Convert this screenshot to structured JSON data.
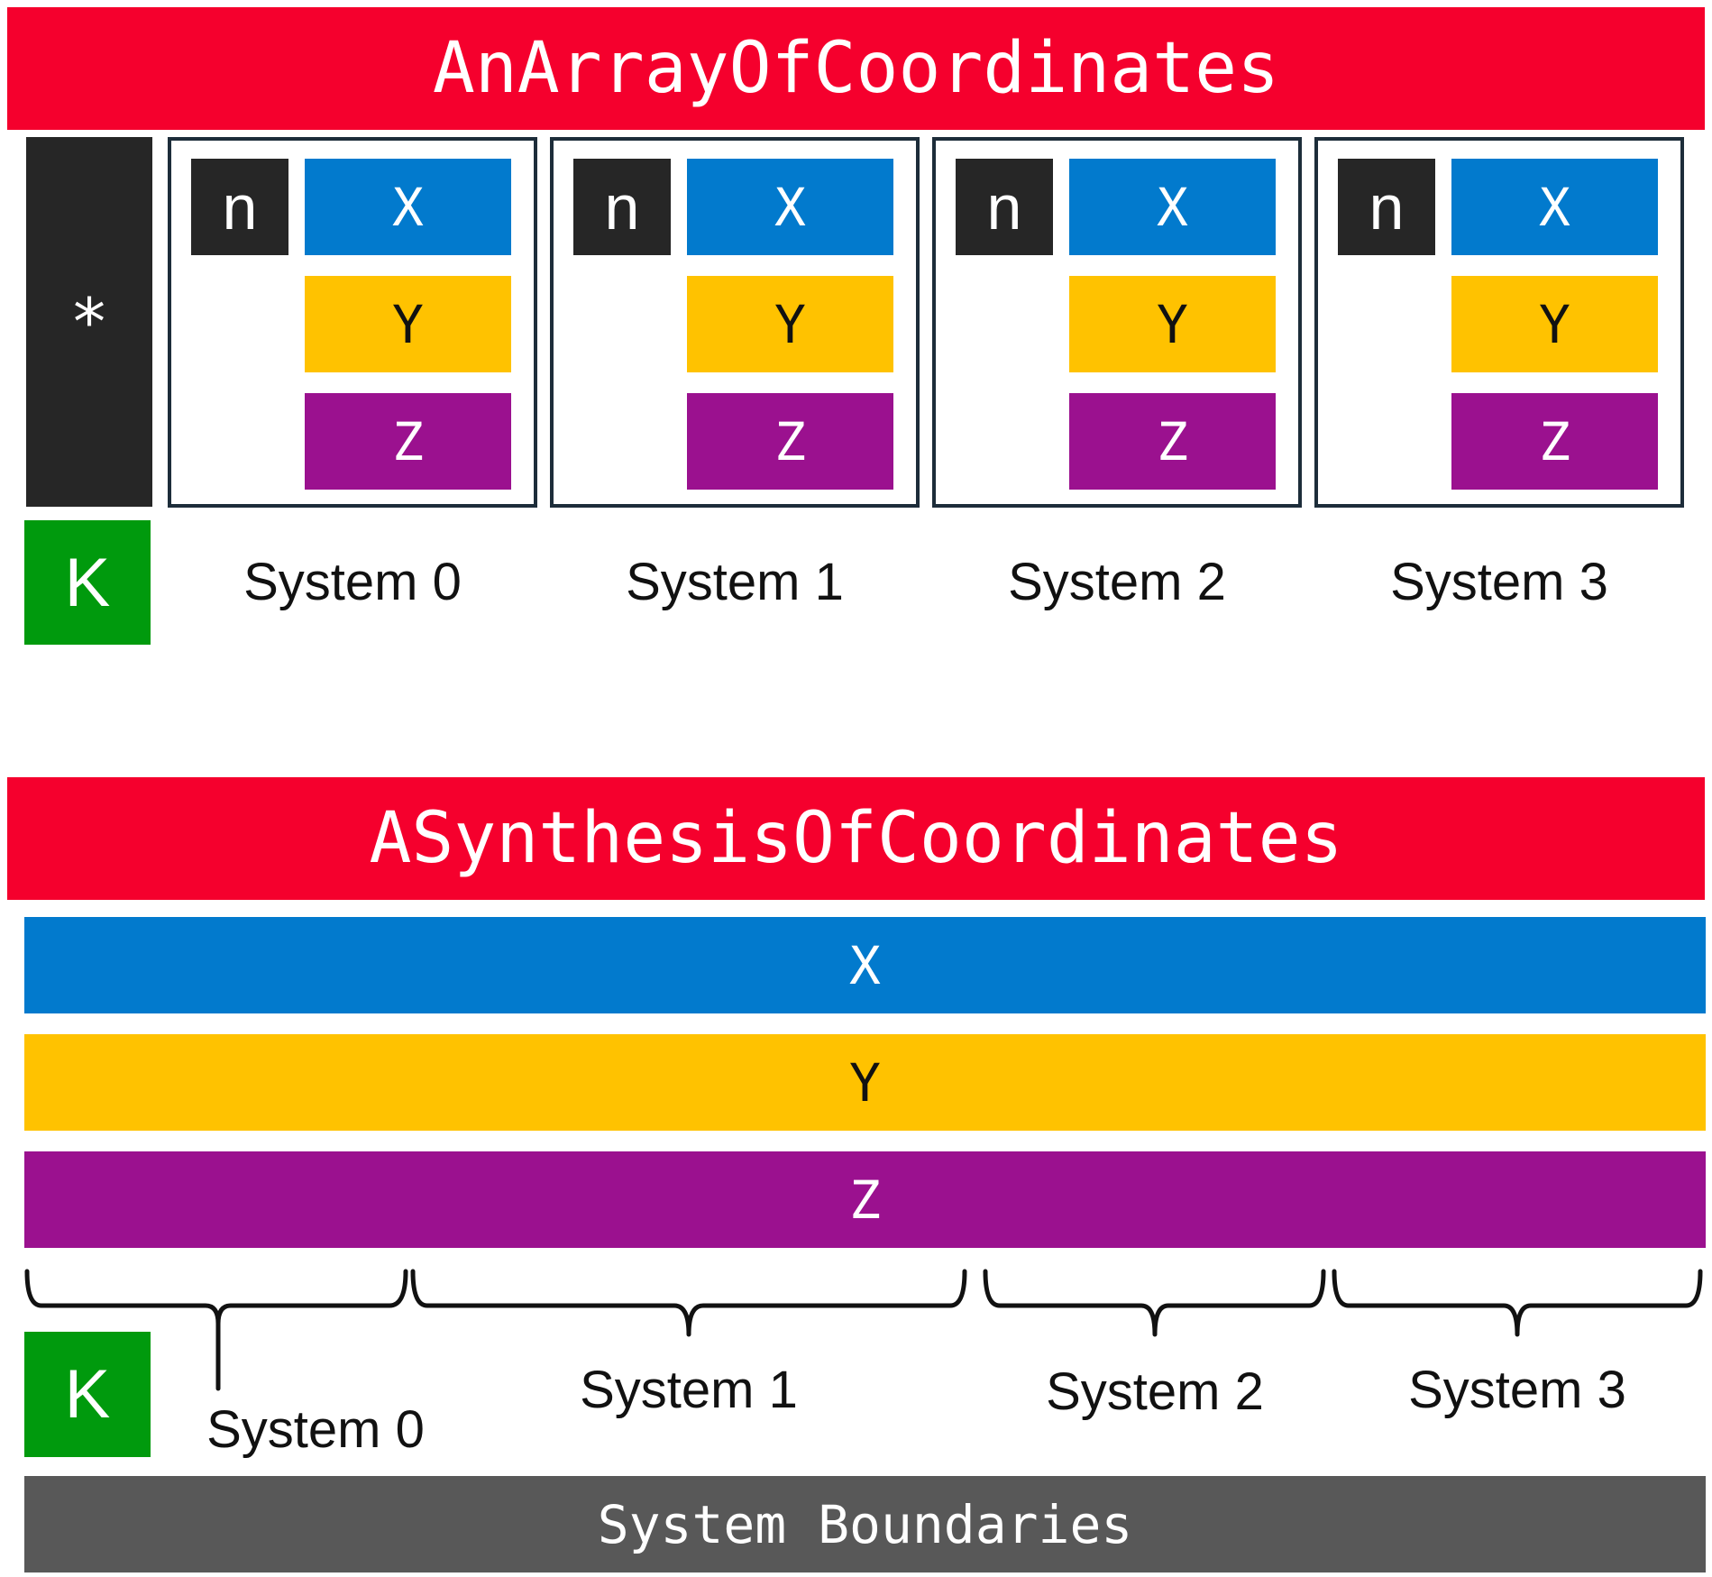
{
  "array_section": {
    "title": "AnArrayOfCoordinates",
    "pointer_label": "*",
    "k_label": "K",
    "systems": [
      {
        "n": "n",
        "x": "X",
        "y": "Y",
        "z": "Z",
        "label": "System 0"
      },
      {
        "n": "n",
        "x": "X",
        "y": "Y",
        "z": "Z",
        "label": "System 1"
      },
      {
        "n": "n",
        "x": "X",
        "y": "Y",
        "z": "Z",
        "label": "System 2"
      },
      {
        "n": "n",
        "x": "X",
        "y": "Y",
        "z": "Z",
        "label": "System 3"
      }
    ]
  },
  "synthesis_section": {
    "title": "ASynthesisOfCoordinates",
    "x_label": "X",
    "y_label": "Y",
    "z_label": "Z",
    "k_label": "K",
    "system_labels": [
      "System 0",
      "System 1",
      "System 2",
      "System 3"
    ],
    "boundaries_label": "System Boundaries"
  },
  "colors": {
    "title_red": "#f5002d",
    "x_blue": "#027acd",
    "y_yellow": "#ffc200",
    "z_purple": "#9b118f",
    "k_green": "#009a0d",
    "n_black": "#262626",
    "boundaries_gray": "#585858"
  }
}
